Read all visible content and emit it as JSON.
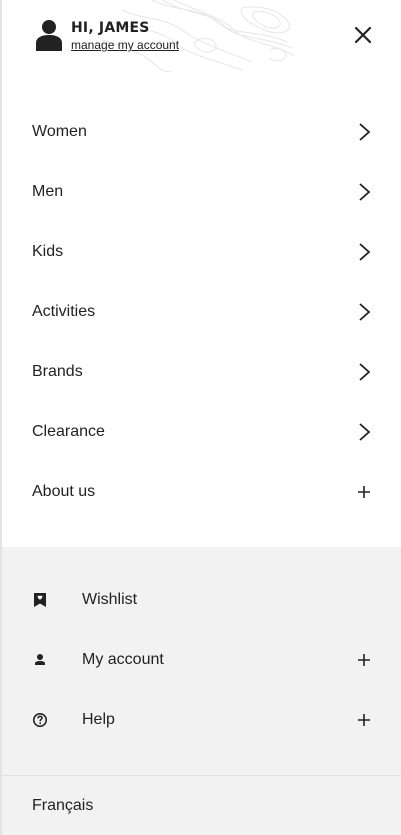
{
  "header": {
    "greeting": "HI, JAMES",
    "manage_link": "manage my account"
  },
  "nav": {
    "items": [
      {
        "label": "Women",
        "icon": "chevron-right-icon"
      },
      {
        "label": "Men",
        "icon": "chevron-right-icon"
      },
      {
        "label": "Kids",
        "icon": "chevron-right-icon"
      },
      {
        "label": "Activities",
        "icon": "chevron-right-icon"
      },
      {
        "label": "Brands",
        "icon": "chevron-right-icon"
      },
      {
        "label": "Clearance",
        "icon": "chevron-right-icon"
      },
      {
        "label": "About us",
        "icon": "plus-icon"
      }
    ]
  },
  "footer": {
    "items": [
      {
        "label": "Wishlist",
        "icon": "wishlist-icon"
      },
      {
        "label": "My account",
        "icon": "person-icon"
      },
      {
        "label": "Help",
        "icon": "help-icon"
      }
    ],
    "language": "Français"
  },
  "colors": {
    "text": "#222222",
    "footer_bg": "#f2f2f2"
  }
}
